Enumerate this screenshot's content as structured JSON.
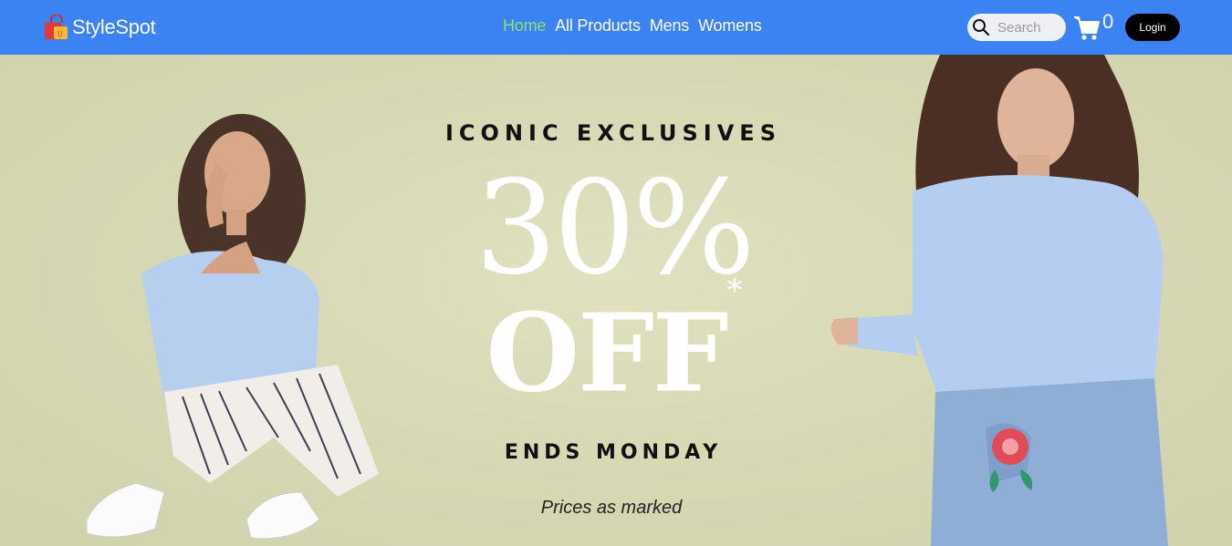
{
  "brand": {
    "name": "StyleSpot",
    "logo_icon": "shopping-bag-icon"
  },
  "nav": {
    "links": [
      {
        "label": "Home",
        "active": true
      },
      {
        "label": "All Products",
        "active": false
      },
      {
        "label": "Mens",
        "active": false
      },
      {
        "label": "Womens",
        "active": false
      }
    ]
  },
  "search": {
    "placeholder": "Search",
    "value": "",
    "icon": "search-icon"
  },
  "cart": {
    "count": "0",
    "icon": "cart-icon"
  },
  "login": {
    "label": "Login"
  },
  "hero": {
    "eyebrow": "ICONIC EXCLUSIVES",
    "discount": "30%",
    "off": "OFF",
    "asterisk": "*",
    "ends": "ENDS MONDAY",
    "note": "Prices as marked"
  },
  "colors": {
    "navbar": "#3b82f2",
    "active_link": "#8fe07a",
    "hero_background": "#d7d9b6",
    "login_button": "#000000"
  }
}
